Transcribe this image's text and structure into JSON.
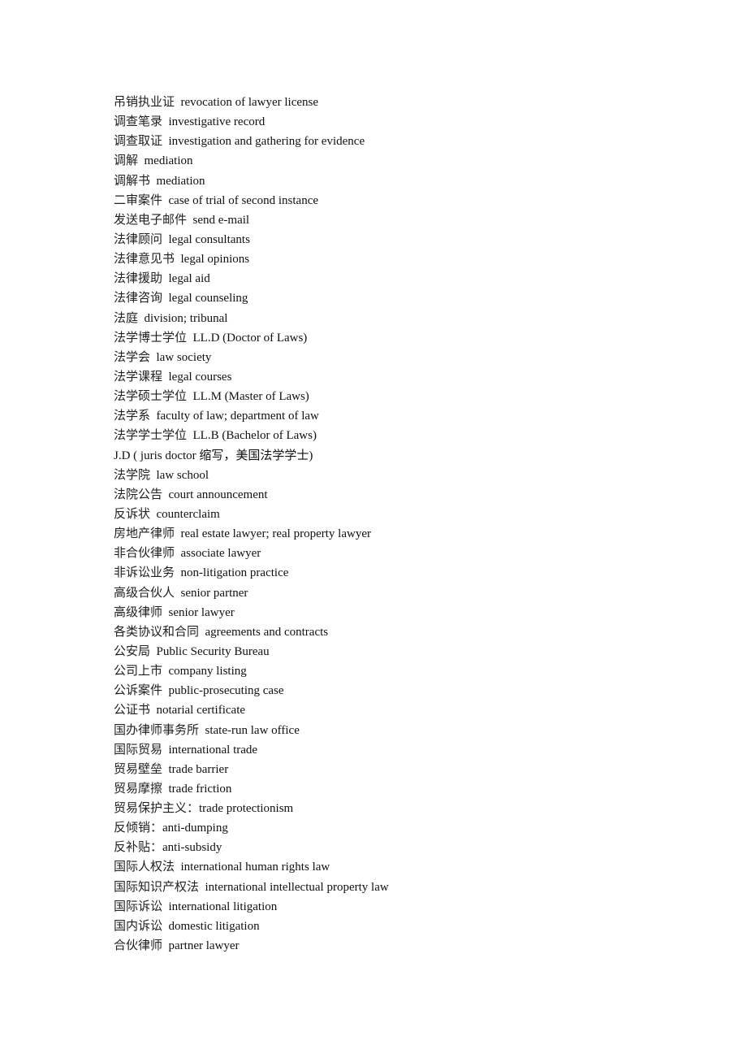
{
  "document": {
    "entries": [
      {
        "zh": "吊销执业证",
        "sep": "  ",
        "en": "revocation of lawyer license"
      },
      {
        "zh": "调查笔录",
        "sep": "  ",
        "en": "investigative record"
      },
      {
        "zh": "调查取证",
        "sep": "  ",
        "en": "investigation and gathering for evidence"
      },
      {
        "zh": "调解",
        "sep": "  ",
        "en": "mediation"
      },
      {
        "zh": "调解书",
        "sep": "  ",
        "en": "mediation"
      },
      {
        "zh": "二审案件",
        "sep": "  ",
        "en": "case of trial of second instance"
      },
      {
        "zh": "发送电子邮件",
        "sep": "  ",
        "en": "send e-mail"
      },
      {
        "zh": "法律顾问",
        "sep": "  ",
        "en": "legal consultants"
      },
      {
        "zh": "法律意见书",
        "sep": "  ",
        "en": "legal opinions"
      },
      {
        "zh": "法律援助",
        "sep": "  ",
        "en": "legal aid"
      },
      {
        "zh": "法律咨询",
        "sep": "  ",
        "en": "legal counseling"
      },
      {
        "zh": "法庭",
        "sep": "  ",
        "en": "division; tribunal"
      },
      {
        "zh": "法学博士学位",
        "sep": "  ",
        "en": "LL.D (Doctor of Laws)"
      },
      {
        "zh": "法学会",
        "sep": "  ",
        "en": "law society"
      },
      {
        "zh": "法学课程",
        "sep": "  ",
        "en": "legal courses"
      },
      {
        "zh": "法学硕士学位",
        "sep": "  ",
        "en": "LL.M (Master of Laws)"
      },
      {
        "zh": "法学系",
        "sep": "  ",
        "en": "faculty of law; department of law"
      },
      {
        "zh": "法学学士学位",
        "sep": "  ",
        "en": "LL.B (Bachelor of Laws)"
      },
      {
        "zh": "",
        "sep": "",
        "en": "J.D ( juris doctor 缩写，美国法学学士)"
      },
      {
        "zh": "法学院",
        "sep": "  ",
        "en": "law school"
      },
      {
        "zh": "法院公告",
        "sep": "  ",
        "en": "court announcement"
      },
      {
        "zh": "反诉状",
        "sep": "  ",
        "en": "counterclaim"
      },
      {
        "zh": "房地产律师",
        "sep": "  ",
        "en": "real estate lawyer; real property lawyer"
      },
      {
        "zh": "非合伙律师",
        "sep": "  ",
        "en": "associate lawyer"
      },
      {
        "zh": "非诉讼业务",
        "sep": "  ",
        "en": "non-litigation practice"
      },
      {
        "zh": "高级合伙人",
        "sep": "  ",
        "en": "senior partner"
      },
      {
        "zh": "高级律师",
        "sep": "  ",
        "en": "senior lawyer"
      },
      {
        "zh": "各类协议和合同",
        "sep": "  ",
        "en": "agreements and contracts"
      },
      {
        "zh": "公安局",
        "sep": "  ",
        "en": "Public Security Bureau"
      },
      {
        "zh": "公司上市",
        "sep": "  ",
        "en": "company listing"
      },
      {
        "zh": "公诉案件",
        "sep": "  ",
        "en": "public-prosecuting case"
      },
      {
        "zh": "公证书",
        "sep": "  ",
        "en": "notarial certificate"
      },
      {
        "zh": "国办律师事务所",
        "sep": "  ",
        "en": "state-run law office"
      },
      {
        "zh": "国际贸易",
        "sep": "  ",
        "en": "international trade"
      },
      {
        "zh": "贸易壁垒",
        "sep": "  ",
        "en": "trade barrier"
      },
      {
        "zh": "贸易摩擦",
        "sep": "  ",
        "en": "trade friction"
      },
      {
        "zh": "贸易保护主义：",
        "sep": "",
        "en": "trade protectionism"
      },
      {
        "zh": "反倾销：",
        "sep": "",
        "en": "anti-dumping"
      },
      {
        "zh": "反补贴：",
        "sep": "",
        "en": "anti-subsidy"
      },
      {
        "zh": "国际人权法",
        "sep": "  ",
        "en": "international human rights law"
      },
      {
        "zh": "国际知识产权法",
        "sep": "  ",
        "en": "international intellectual property law"
      },
      {
        "zh": "国际诉讼",
        "sep": "  ",
        "en": "international litigation"
      },
      {
        "zh": "国内诉讼",
        "sep": "  ",
        "en": "domestic litigation"
      },
      {
        "zh": "合伙律师",
        "sep": "  ",
        "en": "partner lawyer"
      }
    ]
  }
}
